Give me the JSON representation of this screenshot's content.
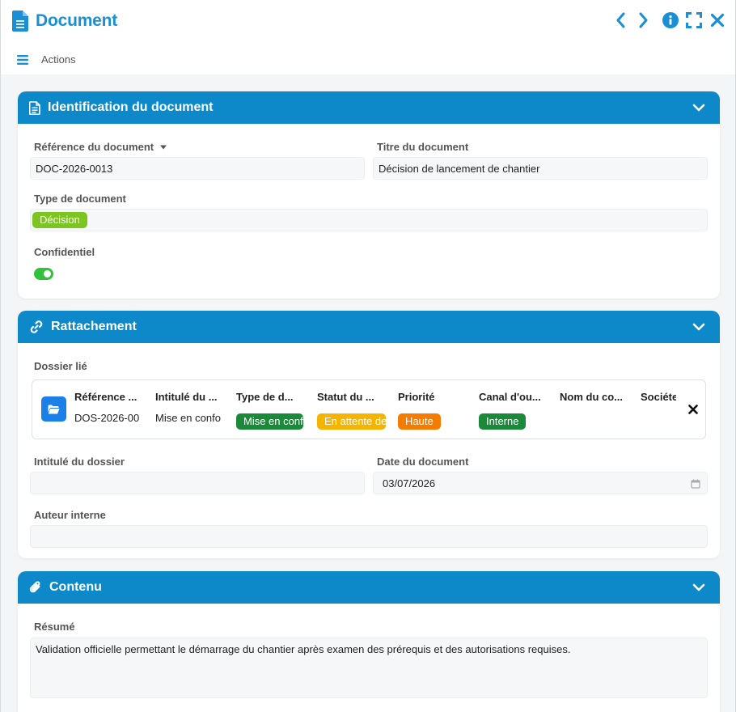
{
  "header": {
    "title": "Document",
    "actions_label": "Actions",
    "icons": [
      "document-icon",
      "chevron-left-icon",
      "chevron-right-icon",
      "info-icon",
      "fullscreen-icon",
      "close-icon",
      "menu-icon"
    ]
  },
  "colors": {
    "brand": "#1a8fd6",
    "panel_header": "#0d88c9",
    "tag_green": "#7cc520",
    "tag_dark_green": "#1a8a3a",
    "tag_yellow": "#f5b400",
    "tag_orange": "#f57c00",
    "toggle_on": "#32c13a"
  },
  "identification": {
    "title": "Identification du document",
    "reference_label": "Référence du document",
    "reference_value": "DOC-2026-0013",
    "titre_label": "Titre du document",
    "titre_value": "Décision de lancement de chantier",
    "type_label": "Type de document",
    "type_value": "Décision",
    "confidentiel_label": "Confidentiel",
    "confidentiel_value": true
  },
  "rattachement": {
    "title": "Rattachement",
    "dossier_label": "Dossier lié",
    "dossier": {
      "columns": [
        "Référence du dossier",
        "Intitulé du dossier",
        "Type de dossier",
        "Statut du dossier",
        "Priorité",
        "Canal d'ouverture",
        "Nom du contact",
        "Société"
      ],
      "columns_display": [
        "Référence ...",
        "Intitulé du ...",
        "Type de d...",
        "Statut du ...",
        "Priorité",
        "Canal d'ou...",
        "Nom du co...",
        "Sociéte"
      ],
      "values": {
        "reference": "DOS-2026-00",
        "intitule": "Mise en confo",
        "type": "Mise en conf",
        "statut": "En attente de",
        "priorite": "Haute",
        "canal": "Interne"
      }
    },
    "intitule_label": "Intitulé du dossier",
    "intitule_value": "",
    "date_label": "Date du document",
    "date_value": "03/07/2026",
    "auteur_label": "Auteur interne",
    "auteur_value": ""
  },
  "contenu": {
    "title": "Contenu",
    "resume_label": "Résumé",
    "resume_value": "Validation officielle permettant le démarrage du chantier après examen des prérequis et des autorisations requises."
  }
}
